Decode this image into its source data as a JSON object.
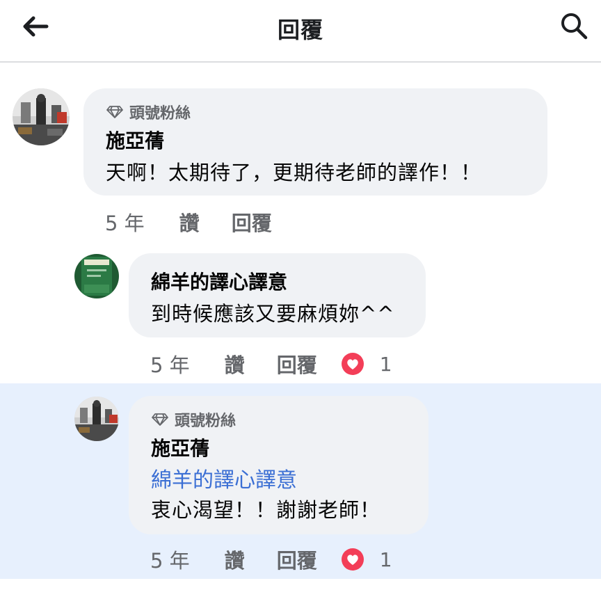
{
  "header": {
    "title": "回覆",
    "back_icon": "arrow-left-icon",
    "search_icon": "search-icon"
  },
  "comments": [
    {
      "badge": "頭號粉絲",
      "author": "施亞蒨",
      "text": "天啊！太期待了，更期待老師的譯作！！",
      "time": "5 年",
      "like": "讚",
      "reply": "回覆"
    },
    {
      "author": "綿羊的譯心譯意",
      "text": "到時候應該又要麻煩妳^^",
      "time": "5 年",
      "like": "讚",
      "reply": "回覆",
      "reaction_count": "1"
    },
    {
      "badge": "頭號粉絲",
      "author": "施亞蒨",
      "mention": "綿羊的譯心譯意",
      "text": "衷心渴望！！謝謝老師！",
      "time": "5 年",
      "like": "讚",
      "reply": "回覆",
      "reaction_count": "1"
    }
  ],
  "colors": {
    "bubble": "#f0f2f5",
    "highlight": "#e7f0fd",
    "mention": "#3b6fd4",
    "love": "#f33e58"
  }
}
